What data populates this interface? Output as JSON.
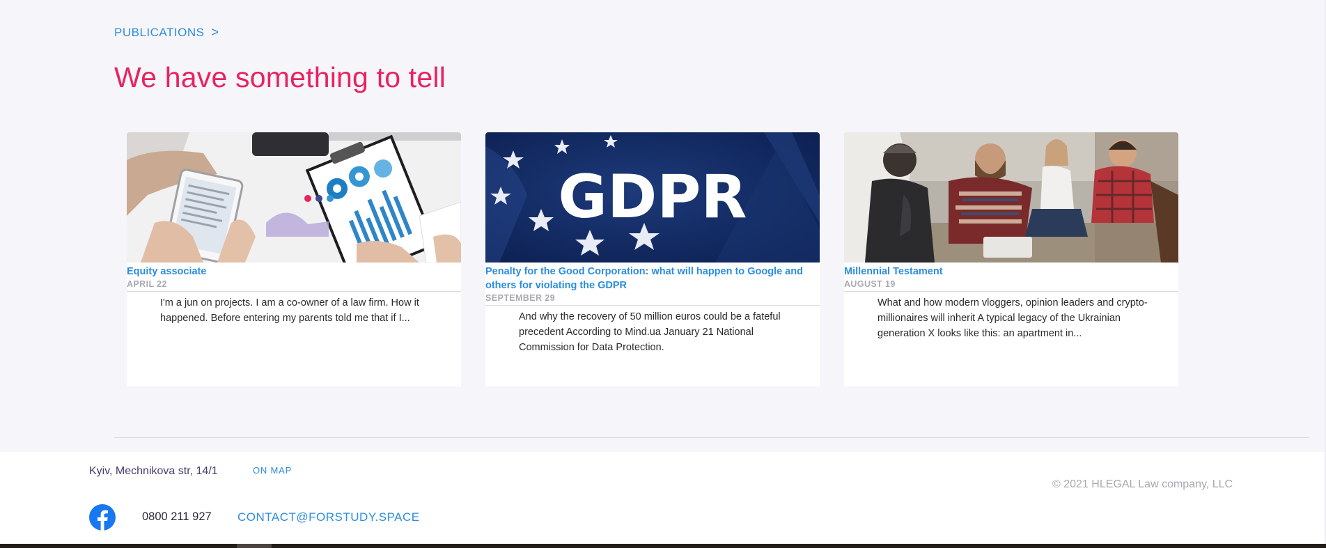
{
  "section": {
    "link_label": "PUBLICATIONS",
    "link_chevron": ">",
    "headline": "We have something to tell"
  },
  "cards": [
    {
      "title": "Equity associate",
      "date": "APRIL 22",
      "excerpt": "I'm a jun on projects. I am a co-owner of a law firm. How it happened. Before entering my parents told me that if I..."
    },
    {
      "title": "Penalty for the Good Corporation: what will happen to Google and others for violating the GDPR",
      "date": "SEPTEMBER 29",
      "excerpt": "And why the recovery of 50 million euros could be a fateful precedent According to Mind.ua January 21 National Commission for Data Protection.",
      "image_text": "GDPR"
    },
    {
      "title": "Millennial Testament",
      "date": "AUGUST 19",
      "excerpt": "What and how modern vloggers, opinion leaders and crypto-millionaires will inherit A typical legacy of the Ukrainian generation X looks like this: an apartment in..."
    }
  ],
  "footer": {
    "address": "Kyiv, Mechnikova str, 14/1",
    "on_map": "ON MAP",
    "copyright": "© 2021 HLEGAL Law company, LLC",
    "phone": "0800 211 927",
    "email": "CONTACT@FORSTUDY.SPACE"
  },
  "colors": {
    "accent": "#2b8de0",
    "headline": "#e8235f",
    "background": "#f6f5fa",
    "facebook": "#1877f2"
  },
  "icons": {
    "facebook": "facebook-icon"
  }
}
